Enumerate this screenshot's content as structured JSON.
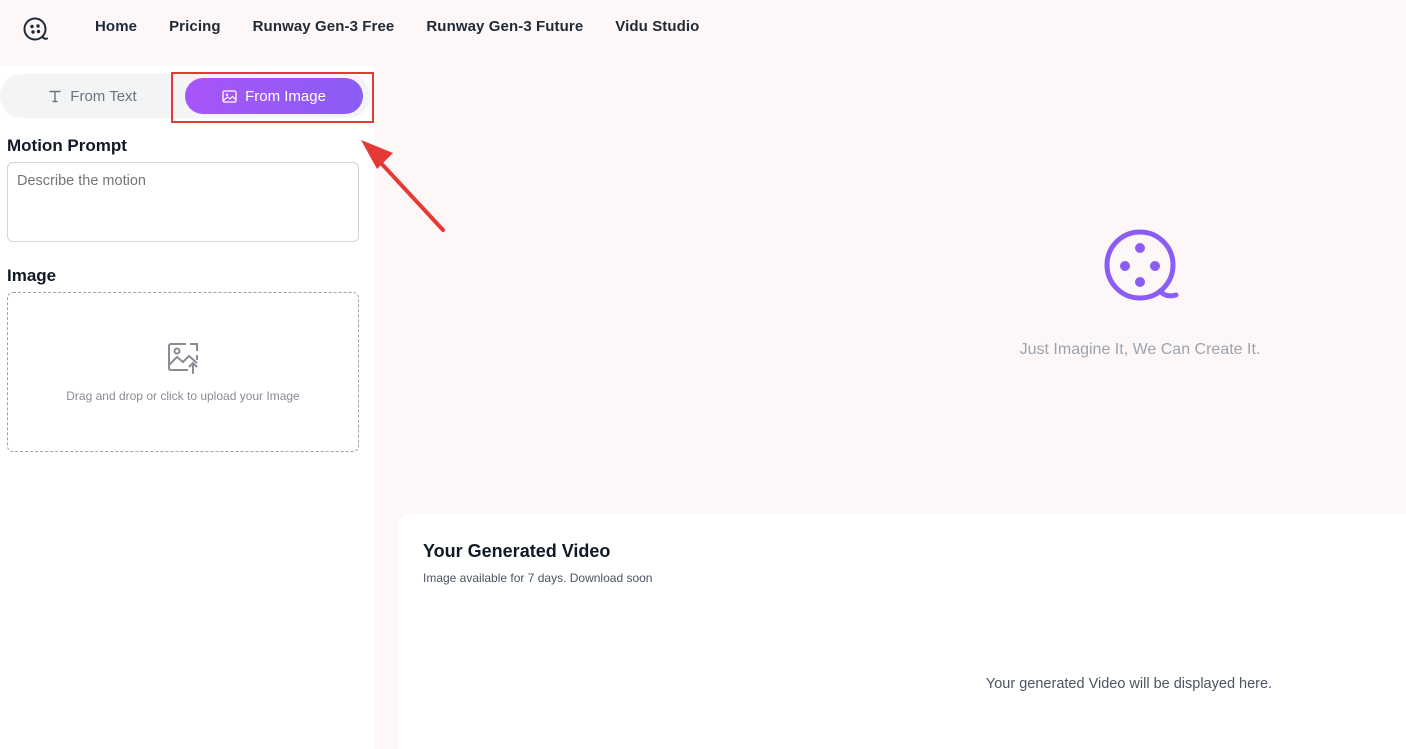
{
  "nav": {
    "logo_icon": "film-reel-icon",
    "items": [
      {
        "label": "Home"
      },
      {
        "label": "Pricing"
      },
      {
        "label": "Runway Gen-3 Free"
      },
      {
        "label": "Runway Gen-3 Future"
      },
      {
        "label": "Vidu Studio"
      }
    ]
  },
  "tabs": {
    "from_text": {
      "label": "From Text",
      "icon": "text-t-icon"
    },
    "from_image": {
      "label": "From Image",
      "icon": "image-icon",
      "active": true
    }
  },
  "form": {
    "motion_label": "Motion Prompt",
    "motion_placeholder": "Describe the motion",
    "image_label": "Image",
    "upload_icon": "image-upload-icon",
    "upload_text": "Drag and drop or click to upload your Image"
  },
  "empty_state": {
    "icon": "film-reel-icon",
    "text": "Just Imagine It, We Can Create It."
  },
  "result": {
    "title": "Your Generated Video",
    "subtitle": "Image available for 7 days. Download soon",
    "placeholder": "Your generated Video will be displayed here."
  },
  "colors": {
    "accent_start": "#a855f7",
    "accent_end": "#8b5cf6",
    "annotation": "#e53935",
    "page_bg": "#fdf8f7"
  }
}
